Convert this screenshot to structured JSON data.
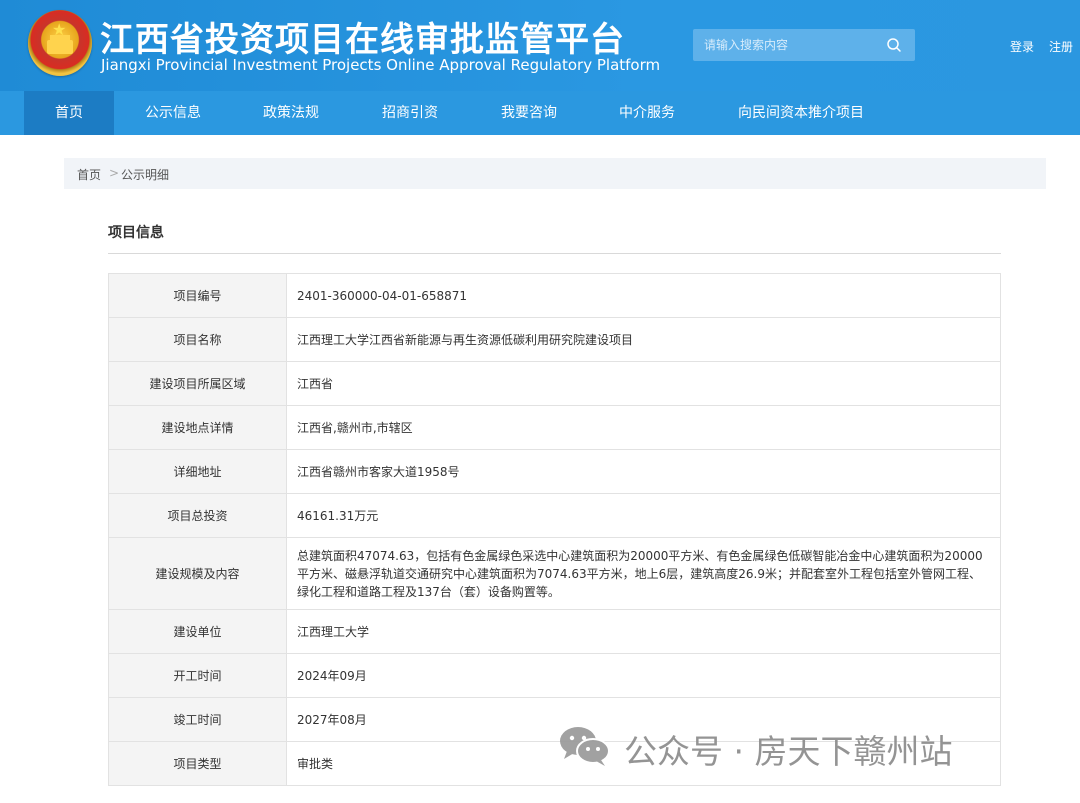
{
  "header": {
    "title_cn": "江西省投资项目在线审批监管平台",
    "title_en": "Jiangxi Provincial Investment Projects Online Approval Regulatory Platform",
    "emblem_icon": "national-emblem-icon"
  },
  "search": {
    "placeholder": "请输入搜索内容",
    "icon": "search-icon"
  },
  "top_links": {
    "login": "登录",
    "register": "注册"
  },
  "nav": {
    "items": [
      "首页",
      "公示信息",
      "政策法规",
      "招商引资",
      "我要咨询",
      "中介服务",
      "向民间资本推介项目"
    ],
    "active": "首页"
  },
  "breadcrumb": {
    "home": "首页",
    "separator": ">",
    "current": "公示明细"
  },
  "section": {
    "title": "项目信息"
  },
  "project": {
    "rows": [
      {
        "label": "项目编号",
        "value": "2401-360000-04-01-658871"
      },
      {
        "label": "项目名称",
        "value": "江西理工大学江西省新能源与再生资源低碳利用研究院建设项目"
      },
      {
        "label": "建设项目所属区域",
        "value": "江西省"
      },
      {
        "label": "建设地点详情",
        "value": "江西省,赣州市,市辖区"
      },
      {
        "label": "详细地址",
        "value": "江西省赣州市客家大道1958号"
      },
      {
        "label": "项目总投资",
        "value": "46161.31万元"
      },
      {
        "label": "建设规模及内容",
        "value": "总建筑面积47074.63，包括有色金属绿色采选中心建筑面积为20000平方米、有色金属绿色低碳智能冶金中心建筑面积为20000平方米、磁悬浮轨道交通研究中心建筑面积为7074.63平方米，地上6层，建筑高度26.9米；并配套室外工程包括室外管网工程、绿化工程和道路工程及137台（套）设备购置等。"
      },
      {
        "label": "建设单位",
        "value": "江西理工大学"
      },
      {
        "label": "开工时间",
        "value": "2024年09月"
      },
      {
        "label": "竣工时间",
        "value": "2027年08月"
      },
      {
        "label": "项目类型",
        "value": "审批类"
      }
    ]
  },
  "watermark": {
    "text": "公众号 · 房天下赣州站",
    "icon": "wechat-icon"
  }
}
